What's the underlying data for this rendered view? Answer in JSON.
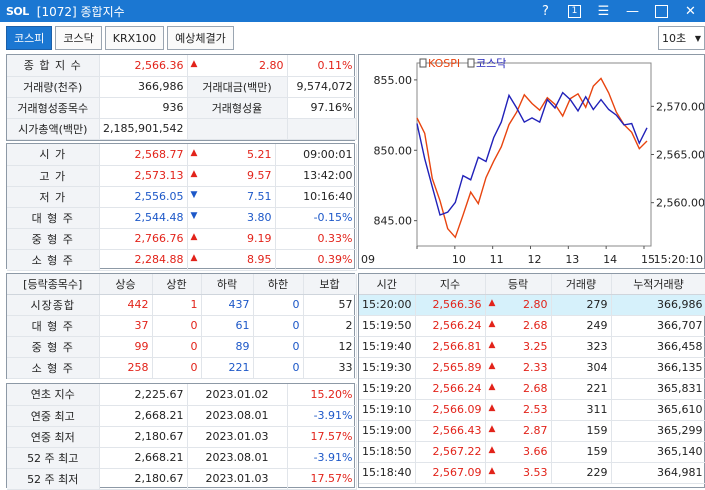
{
  "app": {
    "logo": "SOL",
    "title": "[1072] 종합지수",
    "help": "?",
    "box_num": "1",
    "combo_value": "10초"
  },
  "tabs": [
    "코스피",
    "코스닥",
    "KRX100",
    "예상체결가"
  ],
  "index_info": {
    "index_label": "종 합 지 수",
    "index_value": "2,566.36",
    "index_change": "2.80",
    "index_rate": "0.11%",
    "vol_label": "거래량(천주)",
    "vol_value": "366,986",
    "amt_label": "거래대금(백만)",
    "amt_value": "9,574,072",
    "form_label": "거래형성종목수",
    "form_value": "936",
    "form_rate_label": "거래형성율",
    "form_rate_value": "97.16%",
    "cap_label": "시가총액(백만)",
    "cap_value": "2,185,901,542"
  },
  "ohlc": [
    {
      "label": "시 가",
      "value": "2,568.77",
      "dir": "up",
      "change": "5.21",
      "extra": "09:00:01",
      "extra_color": "black"
    },
    {
      "label": "고 가",
      "value": "2,573.13",
      "dir": "up",
      "change": "9.57",
      "extra": "13:42:00",
      "extra_color": "black"
    },
    {
      "label": "저 가",
      "value": "2,556.05",
      "dir": "dn",
      "change": "7.51",
      "extra": "10:16:40",
      "extra_color": "black"
    },
    {
      "label": "대 형 주",
      "value": "2,544.48",
      "dir": "dn",
      "change": "3.80",
      "extra": "-0.15%",
      "extra_color": "blue"
    },
    {
      "label": "중 형 주",
      "value": "2,766.76",
      "dir": "up",
      "change": "9.19",
      "extra": "0.33%",
      "extra_color": "red"
    },
    {
      "label": "소 형 주",
      "value": "2,284.88",
      "dir": "up",
      "change": "8.95",
      "extra": "0.39%",
      "extra_color": "red"
    }
  ],
  "breadth": {
    "headers": [
      "[등락종목수]",
      "상승",
      "상한",
      "하락",
      "하한",
      "보합"
    ],
    "rows": [
      {
        "label": "시장종합",
        "up": "442",
        "upper": "1",
        "down": "437",
        "lower": "0",
        "flat": "57"
      },
      {
        "label": "대 형 주",
        "up": "37",
        "upper": "0",
        "down": "61",
        "lower": "0",
        "flat": "2"
      },
      {
        "label": "중 형 주",
        "up": "99",
        "upper": "0",
        "down": "89",
        "lower": "0",
        "flat": "12"
      },
      {
        "label": "소 형 주",
        "up": "258",
        "upper": "0",
        "down": "221",
        "lower": "0",
        "flat": "33"
      }
    ]
  },
  "yearly": [
    {
      "label": "연초 지수",
      "value": "2,225.67",
      "date": "2023.01.02",
      "rate": "15.20%",
      "color": "red"
    },
    {
      "label": "연중 최고",
      "value": "2,668.21",
      "date": "2023.08.01",
      "rate": "-3.91%",
      "color": "blue"
    },
    {
      "label": "연중 최저",
      "value": "2,180.67",
      "date": "2023.01.03",
      "rate": "17.57%",
      "color": "red"
    },
    {
      "label": "52 주 최고",
      "value": "2,668.21",
      "date": "2023.08.01",
      "rate": "-3.91%",
      "color": "blue"
    },
    {
      "label": "52 주 최저",
      "value": "2,180.67",
      "date": "2023.01.03",
      "rate": "17.57%",
      "color": "red"
    }
  ],
  "ticks": {
    "headers": [
      "시간",
      "지수",
      "등락",
      "거래량",
      "누적거래량"
    ],
    "rows": [
      {
        "time": "15:20:00",
        "index": "2,566.36",
        "change": "2.80",
        "vol": "279",
        "cum": "366,986"
      },
      {
        "time": "15:19:50",
        "index": "2,566.24",
        "change": "2.68",
        "vol": "249",
        "cum": "366,707"
      },
      {
        "time": "15:19:40",
        "index": "2,566.81",
        "change": "3.25",
        "vol": "323",
        "cum": "366,458"
      },
      {
        "time": "15:19:30",
        "index": "2,565.89",
        "change": "2.33",
        "vol": "304",
        "cum": "366,135"
      },
      {
        "time": "15:19:20",
        "index": "2,566.24",
        "change": "2.68",
        "vol": "221",
        "cum": "365,831"
      },
      {
        "time": "15:19:10",
        "index": "2,566.09",
        "change": "2.53",
        "vol": "311",
        "cum": "365,610"
      },
      {
        "time": "15:19:00",
        "index": "2,566.43",
        "change": "2.87",
        "vol": "159",
        "cum": "365,299"
      },
      {
        "time": "15:18:50",
        "index": "2,567.22",
        "change": "3.66",
        "vol": "159",
        "cum": "365,140"
      },
      {
        "time": "15:18:40",
        "index": "2,567.09",
        "change": "3.53",
        "vol": "229",
        "cum": "364,981"
      }
    ]
  },
  "chart_data": {
    "type": "line",
    "legend": [
      "KOSPI",
      "코스닥"
    ],
    "left_axis_ticks": [
      "855.00",
      "850.00",
      "845.00"
    ],
    "left_axis_values": [
      855,
      850,
      845
    ],
    "right_axis_ticks": [
      "2,570.00",
      "2,565.00",
      "2,560.00"
    ],
    "right_axis_values": [
      2570,
      2565,
      2560
    ],
    "x_ticks": [
      "09",
      "10",
      "11",
      "12",
      "13",
      "14",
      "15"
    ],
    "last_time": "15:20:10",
    "ylim_left": [
      843.2,
      856.2
    ],
    "ylim_right": [
      2555.5,
      2574.5
    ],
    "series": [
      {
        "name": "KOSPI",
        "color": "#e8440f",
        "values": [
          2568.8,
          2567.2,
          2562.5,
          2560.2,
          2557.3,
          2556.4,
          2558.7,
          2561.1,
          2559.9,
          2562.6,
          2564.3,
          2565.8,
          2568.1,
          2569.4,
          2571.2,
          2570.3,
          2569.6,
          2570.9,
          2570.2,
          2569.0,
          2570.8,
          2571.3,
          2569.9,
          2572.1,
          2572.9,
          2571.4,
          2569.4,
          2568.1,
          2567.3,
          2565.6,
          2566.4
        ]
      },
      {
        "name": "코스닥",
        "color": "#2121b9",
        "values": [
          851.9,
          849.4,
          847.4,
          845.4,
          845.6,
          846.3,
          848.2,
          847.9,
          849.5,
          849.2,
          850.9,
          852.0,
          853.9,
          853.0,
          852.0,
          852.3,
          852.0,
          853.6,
          853.0,
          854.1,
          853.6,
          852.8,
          853.8,
          852.9,
          853.6,
          852.9,
          852.5,
          851.8,
          851.9,
          850.5,
          851.6
        ]
      }
    ]
  }
}
